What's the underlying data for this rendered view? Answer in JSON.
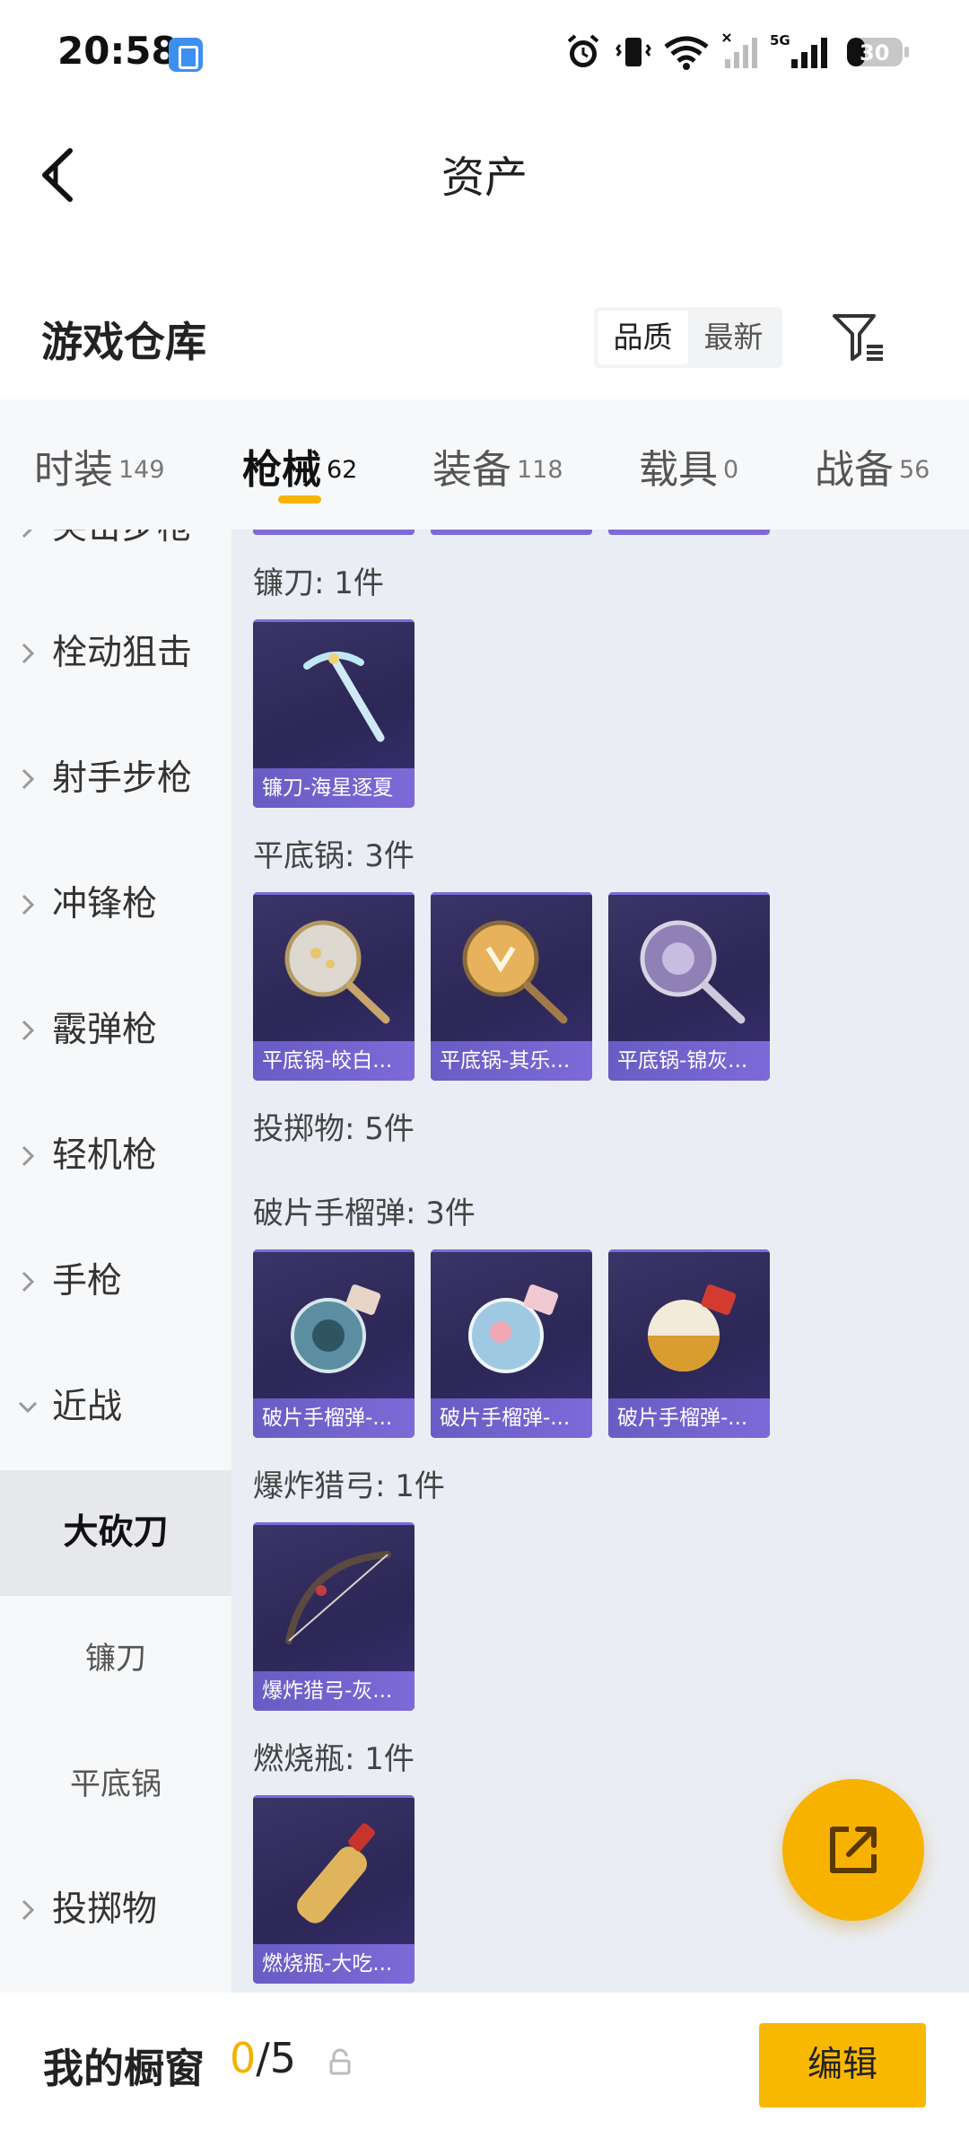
{
  "status": {
    "time": "20:58",
    "battery": "30",
    "network": "5G"
  },
  "header": {
    "title": "资产"
  },
  "warehouse": {
    "title": "游戏仓库",
    "sort_options": [
      "品质",
      "最新"
    ],
    "active_sort": "品质"
  },
  "tabs": [
    {
      "label": "时装",
      "count": "149",
      "active": false
    },
    {
      "label": "枪械",
      "count": "62",
      "active": true
    },
    {
      "label": "装备",
      "count": "118",
      "active": false
    },
    {
      "label": "载具",
      "count": "0",
      "active": false
    },
    {
      "label": "战备",
      "count": "56",
      "active": false
    }
  ],
  "sidebar": {
    "items": [
      {
        "label": "突击步枪"
      },
      {
        "label": "栓动狙击"
      },
      {
        "label": "射手步枪"
      },
      {
        "label": "冲锋枪"
      },
      {
        "label": "霰弹枪"
      },
      {
        "label": "轻机枪"
      },
      {
        "label": "手枪"
      },
      {
        "label": "近战"
      },
      {
        "label": "大砍刀"
      },
      {
        "label": "镰刀"
      },
      {
        "label": "平底锅"
      },
      {
        "label": "投掷物"
      }
    ]
  },
  "content": {
    "groups": [
      {
        "label": "镰刀: 1件",
        "items": [
          "镰刀-海星逐夏"
        ]
      },
      {
        "label": "平底锅: 3件",
        "items": [
          "平底锅-皎白...",
          "平底锅-其乐...",
          "平底锅-锦灰..."
        ]
      },
      {
        "label": "投掷物: 5件",
        "items": []
      },
      {
        "label": "破片手榴弹: 3件",
        "items": [
          "破片手榴弹-...",
          "破片手榴弹-...",
          "破片手榴弹-..."
        ]
      },
      {
        "label": "爆炸猎弓: 1件",
        "items": [
          "爆炸猎弓-灰..."
        ]
      },
      {
        "label": "燃烧瓶: 1件",
        "items": [
          "燃烧瓶-大吃..."
        ]
      }
    ]
  },
  "bottom": {
    "showcase_label": "我的橱窗",
    "showcase_used": "0",
    "showcase_sep": "/",
    "showcase_total": "5",
    "edit_label": "编辑"
  },
  "colors": {
    "accent": "#f7b200",
    "card_bg": "#2c2756",
    "card_caption": "#7d6ad8"
  },
  "icons": [
    "back-arrow-icon",
    "filter-icon",
    "share-icon",
    "lock-icon",
    "chevron-right-icon",
    "chevron-down-icon"
  ]
}
